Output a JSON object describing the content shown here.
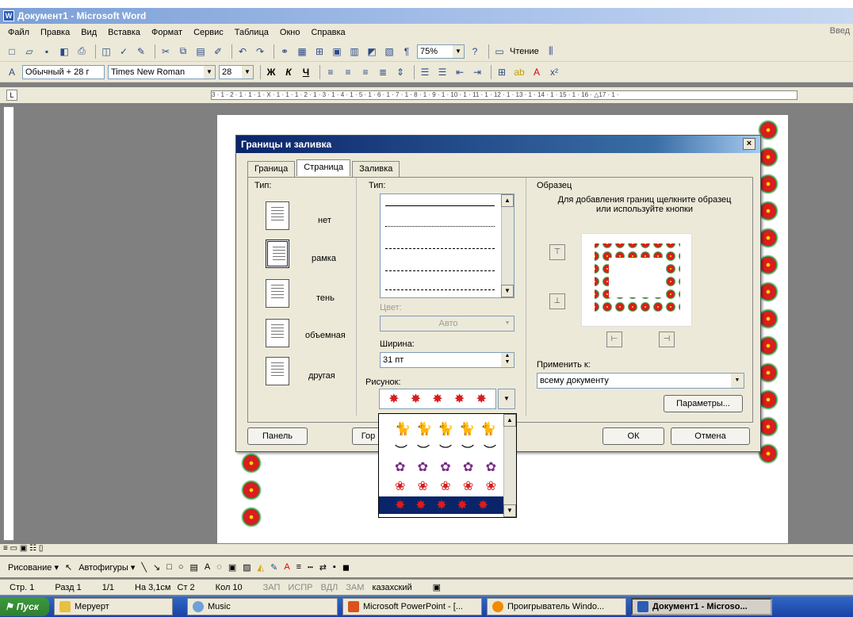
{
  "window": {
    "title": "Документ1 - Microsoft Word"
  },
  "menu": {
    "items": [
      "Файл",
      "Правка",
      "Вид",
      "Вставка",
      "Формат",
      "Сервис",
      "Таблица",
      "Окно",
      "Справка"
    ],
    "help_hint": "Введ"
  },
  "toolbar": {
    "zoom": "75%",
    "reading": "Чтение",
    "style": "Обычный + 28 г",
    "font": "Times New Roman",
    "size": "28",
    "bold": "Ж",
    "italic": "К",
    "underline": "Ч"
  },
  "ruler": {
    "text": "3 · 1 · 2 · 1 · 1 · 1 · X · 1 · 1 · 1 · 2 · 1 · 3 · 1 · 4 · 1 · 5 · 1 · 6 · 1 · 7 · 1 · 8 · 1 · 9 · 1 · 10 · 1 · 11 · 1 · 12 · 1 · 13 · 1 · 14 · 1 · 15 · 1 · 16 · △17 · 1 ·",
    "corner": "L"
  },
  "dialog": {
    "title": "Границы и заливка",
    "close": "×",
    "tabs": [
      "Граница",
      "Страница",
      "Заливка"
    ],
    "type_label": "Тип:",
    "types": [
      "нет",
      "рамка",
      "тень",
      "объемная",
      "другая"
    ],
    "style_label": "Тип:",
    "color_label": "Цвет:",
    "color_value": "Авто",
    "width_label": "Ширина:",
    "width_value": "31 пт",
    "art_label": "Рисунок:",
    "sample_label": "Образец",
    "sample_hint": "Для добавления границ щелкните образец или используйте кнопки",
    "apply_label": "Применить к:",
    "apply_value": "всему документу",
    "params_button": "Параметры...",
    "panel_button": "Панель",
    "hline_button": "Гор",
    "ok_button": "ОК",
    "cancel_button": "Отмена"
  },
  "drawbar": {
    "draw": "Рисование ▾",
    "autoshapes": "Автофигуры ▾"
  },
  "status": {
    "page": "Стр. 1",
    "section": "Разд 1",
    "pages": "1/1",
    "at": "На 3,1см",
    "line": "Ст 2",
    "col": "Кол 10",
    "rec": "ЗАП",
    "trk": "ИСПР",
    "ext": "ВДЛ",
    "ovr": "ЗАМ",
    "lang": "казахский"
  },
  "taskbar": {
    "start": "Пуск",
    "tasks": [
      "Меруерт",
      "Music",
      "Microsoft PowerPoint - [...",
      "Проигрыватель Windo...",
      "Документ1 - Microso..."
    ]
  },
  "colors": {
    "title_blue": "#0a246a",
    "flower_red": "#d81e1e",
    "leaf_green": "#1f8a2f"
  }
}
